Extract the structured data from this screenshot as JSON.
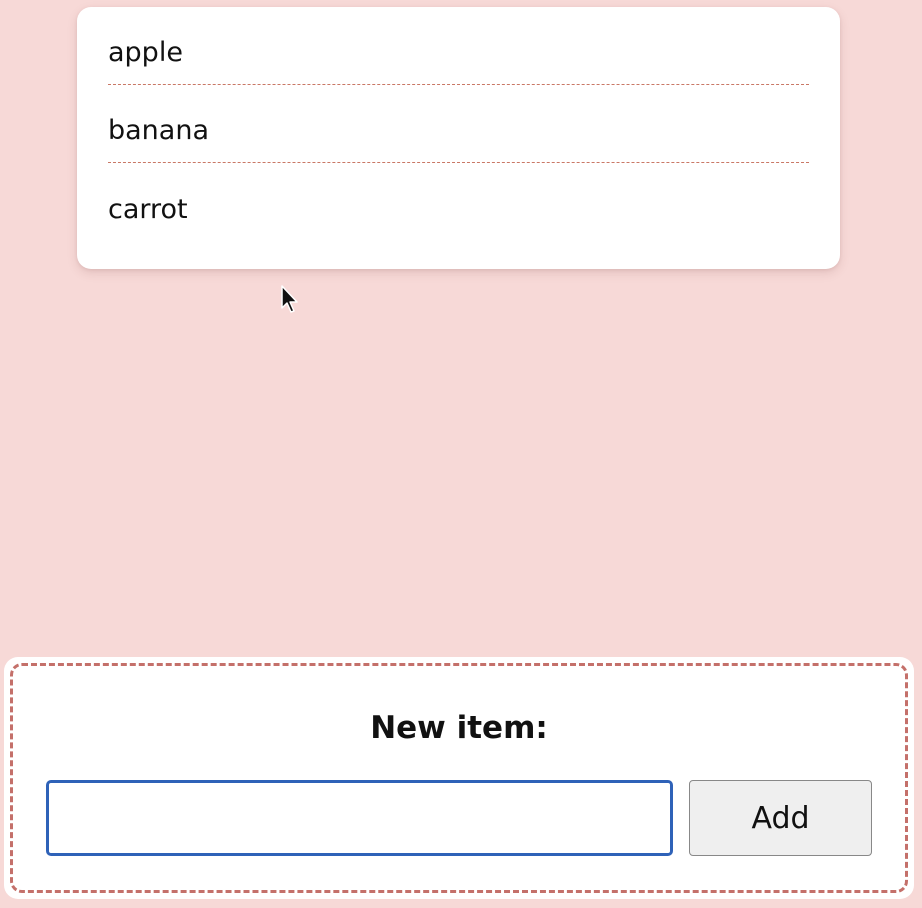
{
  "list": {
    "items": [
      {
        "label": "apple"
      },
      {
        "label": "banana"
      },
      {
        "label": "carrot"
      }
    ]
  },
  "form": {
    "label": "New item:",
    "input_value": "",
    "add_button_label": "Add"
  },
  "colors": {
    "page_background": "#f7d9d7",
    "divider": "#c97866",
    "panel_border": "#c4706a",
    "input_focus_border": "#2f62b8"
  },
  "icons": {
    "cursor": "mouse-pointer-icon"
  }
}
